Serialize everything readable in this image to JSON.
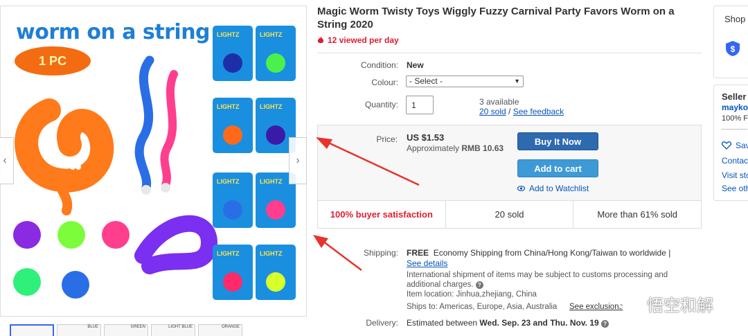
{
  "gallery": {
    "image_title": "worm on a string",
    "badge": "1 PC",
    "package_label": "LIGHTZ",
    "prev_label": "‹",
    "next_label": "›",
    "thumbs": [
      "",
      "BLUE",
      "GREEN",
      "LIGHT BLUE",
      "ORANGE"
    ]
  },
  "listing": {
    "title": "Magic Worm Twisty Toys Wiggly Fuzzy Carnival Party Favors Worm on a String 2020",
    "views": "12 viewed per day"
  },
  "details": {
    "condition_label": "Condition:",
    "condition_value": "New",
    "colour_label": "Colour:",
    "colour_select": "- Select -",
    "quantity_label": "Quantity:",
    "quantity_value": "1",
    "available": "3 available",
    "sold_link": "20 sold",
    "separator": "/",
    "feedback_link": "See feedback"
  },
  "price": {
    "label": "Price:",
    "value": "US $1.53",
    "approx_prefix": "Approximately",
    "approx_value": "RMB 10.63",
    "buy_now": "Buy It Now",
    "add_to_cart": "Add to cart",
    "watchlist": "Add to Watchlist",
    "stats": [
      "100% buyer satisfaction",
      "20 sold",
      "More than 61% sold"
    ]
  },
  "shipping": {
    "label": "Shipping:",
    "free": "FREE",
    "method": "Economy Shipping from China/Hong Kong/Taiwan to worldwide |",
    "see_details": "See details",
    "customs_note": "International shipment of items may be subject to customs processing and additional charges.",
    "item_location": "Item location:  Jinhua,zhejiang, China",
    "ships_to": "Ships to:  Americas, Europe, Asia, Australia",
    "see_exclusions": "See exclusions"
  },
  "delivery": {
    "label": "Delivery:",
    "prefix": "Estimated between",
    "range": "Wed. Sep. 23 and Thu. Nov. 19"
  },
  "shop_card": {
    "title": "Shop"
  },
  "seller_card": {
    "title": "Seller",
    "name": "mayko",
    "feedback": "100% F",
    "save": "Sav",
    "contact": "Contact",
    "visit": "Visit sto",
    "see_other": "See oth"
  },
  "watermark": {
    "text": "悟空和解"
  },
  "colors": {
    "accent_blue": "#0654ba",
    "buy_button": "#2d6ab0",
    "cart_button": "#3d9ad6",
    "alert_red": "#dd1e31",
    "annotation_arrow": "#e8322c"
  }
}
